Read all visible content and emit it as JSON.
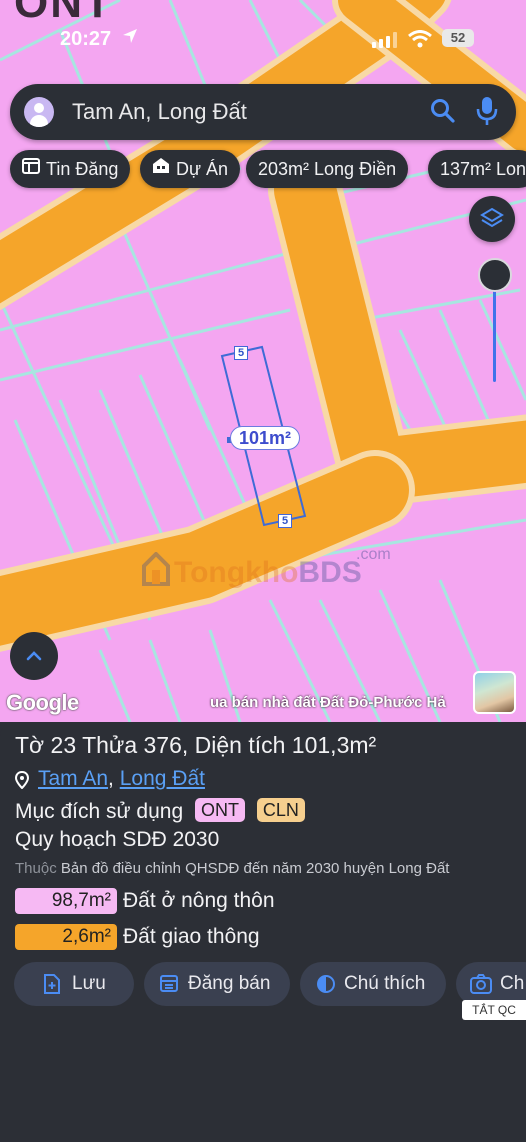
{
  "map": {
    "zone_code": "ONT",
    "plot_area": "101m²",
    "edge_top": "5",
    "edge_bottom": "5",
    "watermark_a": "Tongkho",
    "watermark_b": "BDS",
    "watermark_com": ".com",
    "google": "Google",
    "ticker": "ua bán nhà đất Đất Đỏ-Phước Hả"
  },
  "status_bar": {
    "time": "20:27",
    "battery": "52"
  },
  "search": {
    "text": "Tam An, Long Đất"
  },
  "chips": [
    {
      "label": "Tin Đăng",
      "icon": "newspaper-icon"
    },
    {
      "label": "Dự Án",
      "icon": "building-icon"
    },
    {
      "label": "203m² Long Điền"
    },
    {
      "label": "137m² Lon"
    }
  ],
  "panel": {
    "title": "Tờ 23 Thửa 376, Diện tích 101,3m²",
    "ward": "Tam An",
    "sep": ",",
    "district": "Long Đất",
    "purpose_label": "Mục đích sử dụng",
    "badges": [
      {
        "text": "ONT",
        "color": "#f6b9f3"
      },
      {
        "text": "CLN",
        "color": "#f6cf8e"
      }
    ],
    "plan": "Quy hoạch SDĐ 2030",
    "desc_prefix": "Thuộc",
    "desc": "Bản đồ điều chỉnh QHSDĐ đến năm 2030 huyện Long Đất",
    "areas": [
      {
        "value": "98,7m²",
        "label": "Đất ở nông thôn",
        "color": "#f6b9f3"
      },
      {
        "value": "2,6m²",
        "label": "Đất giao thông",
        "color": "#f5a52a"
      }
    ],
    "actions": [
      {
        "label": "Lưu",
        "icon": "save-icon"
      },
      {
        "label": "Đăng bán",
        "icon": "calendar-icon"
      },
      {
        "label": "Chú thích",
        "icon": "legend-icon"
      },
      {
        "label": "Ch",
        "icon": "camera-icon"
      }
    ],
    "ad_tag": "TẮT QC"
  }
}
